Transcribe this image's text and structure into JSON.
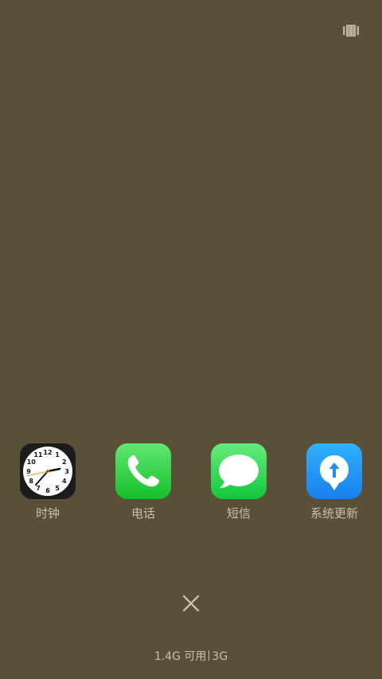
{
  "top_bar": {
    "icon": "card-stack-icon"
  },
  "dock": {
    "apps": [
      {
        "label": "时钟",
        "icon": "clock-icon"
      },
      {
        "label": "电话",
        "icon": "phone-icon"
      },
      {
        "label": "短信",
        "icon": "messages-icon"
      },
      {
        "label": "系统更新",
        "icon": "system-update-icon"
      }
    ]
  },
  "clock_face": {
    "numbers": [
      "12",
      "1",
      "2",
      "3",
      "4",
      "5",
      "6",
      "7",
      "8",
      "9",
      "10",
      "11"
    ]
  },
  "close": {
    "icon": "close-icon"
  },
  "status": {
    "memory_available": "1.4G 可用",
    "network": "3G"
  },
  "colors": {
    "background": "#595037",
    "phone_green": "#2fc940",
    "messages_green": "#2bd348",
    "update_blue": "#1f8ff5",
    "label_text": "#c8c0a8"
  }
}
